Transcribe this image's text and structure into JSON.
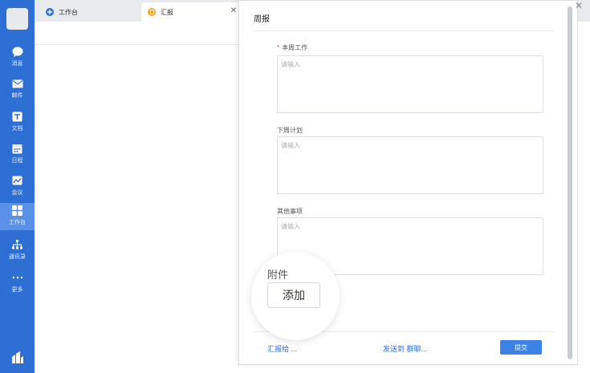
{
  "sidebar": {
    "items": [
      {
        "label": "消息",
        "icon": "chat-icon"
      },
      {
        "label": "邮件",
        "icon": "mail-icon"
      },
      {
        "label": "文档",
        "icon": "doc-icon"
      },
      {
        "label": "日程",
        "icon": "calendar-icon"
      },
      {
        "label": "会议",
        "icon": "meeting-icon"
      },
      {
        "label": "工作台",
        "icon": "workspace-icon",
        "active": true
      },
      {
        "label": "通讯录",
        "icon": "contacts-icon"
      },
      {
        "label": "更多",
        "icon": "more-icon"
      }
    ]
  },
  "tabs": [
    {
      "label": "工作台",
      "icon": "workspace-tab-icon"
    },
    {
      "label": "汇报",
      "icon": "report-tab-icon"
    }
  ],
  "panel": {
    "title": "周报",
    "fields": [
      {
        "label": "本周工作",
        "placeholder": "请输入",
        "required": true
      },
      {
        "label": "下周计划",
        "placeholder": "请输入",
        "required": false
      },
      {
        "label": "其他事项",
        "placeholder": "请输入",
        "required": false
      }
    ],
    "attachment": {
      "label": "附件",
      "add_button": "添加"
    },
    "footer": {
      "report_to": "汇报给 ...",
      "send_to": "发送到 群聊...",
      "submit": "提交"
    }
  },
  "colors": {
    "accent": "#2d6fd4",
    "submit": "#3b82e6",
    "required": "#e34d4d"
  }
}
